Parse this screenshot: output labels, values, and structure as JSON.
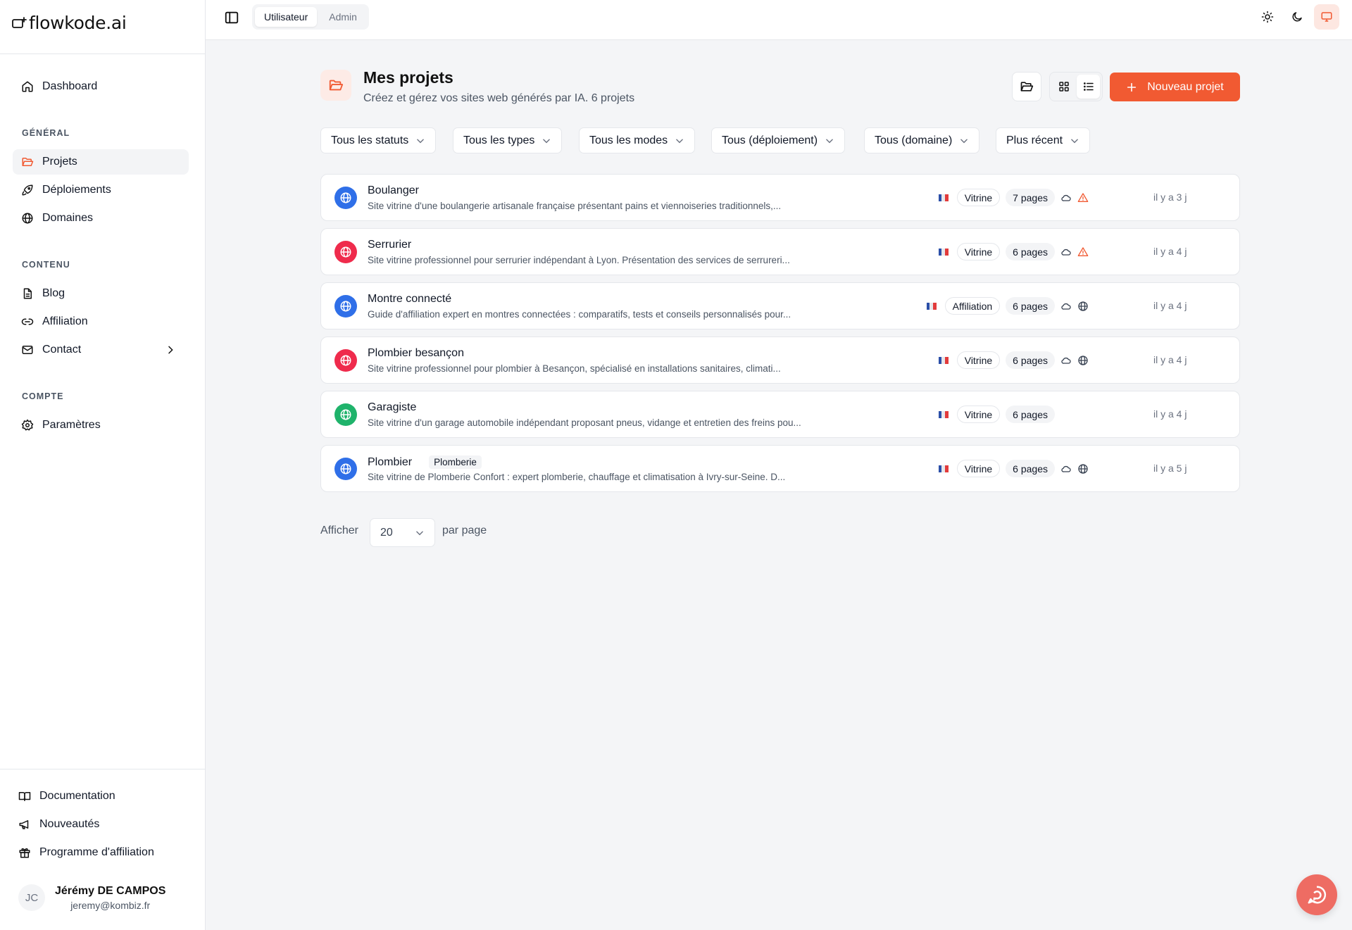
{
  "app": {
    "logo_text": "flowkode.ai",
    "accent": "#f15a32"
  },
  "sidebar": {
    "dashboard": "Dashboard",
    "sections": {
      "general": "GÉNÉRAL",
      "content": "CONTENU",
      "account": "COMPTE"
    },
    "items": {
      "projets": "Projets",
      "deploiements": "Déploiements",
      "domaines": "Domaines",
      "blog": "Blog",
      "affiliation": "Affiliation",
      "contact": "Contact",
      "parametres": "Paramètres"
    },
    "footer": {
      "documentation": "Documentation",
      "nouveautes": "Nouveautés",
      "programme": "Programme d'affiliation"
    },
    "user": {
      "initials": "JC",
      "name": "Jérémy DE CAMPOS",
      "email": "jeremy@kombiz.fr"
    }
  },
  "topbar": {
    "roles": [
      "Utilisateur",
      "Admin"
    ],
    "active_role": "Utilisateur",
    "theme_active": "system"
  },
  "page": {
    "title": "Mes projets",
    "subtitle": "Créez et gérez vos sites web générés par IA. 6 projets",
    "new_button": "Nouveau projet",
    "view_active": "list"
  },
  "filters": {
    "status": "Tous les statuts",
    "types": "Tous les types",
    "modes": "Tous les modes",
    "deployment": "Tous (déploiement)",
    "domain": "Tous (domaine)",
    "sort": "Plus récent"
  },
  "projects": [
    {
      "name": "Boulanger",
      "tag": "",
      "desc": "Site vitrine d'une boulangerie artisanale française présentant pains et viennoiseries traditionnels,...",
      "type": "Vitrine",
      "pages": "7 pages",
      "status_icon": "warning-icon",
      "time": "il y a 3 j",
      "color": "#2f6fe8"
    },
    {
      "name": "Serrurier",
      "tag": "",
      "desc": "Site vitrine professionnel pour serrurier indépendant à Lyon. Présentation des services de serrureri...",
      "type": "Vitrine",
      "pages": "6 pages",
      "status_icon": "warning-icon",
      "time": "il y a 4 j",
      "color": "#ef2b4c"
    },
    {
      "name": "Montre connecté",
      "tag": "",
      "desc": "Guide d'affiliation expert en montres connectées : comparatifs, tests et conseils personnalisés pour...",
      "type": "Affiliation",
      "pages": "6 pages",
      "status_icon": "globe-icon",
      "time": "il y a 4 j",
      "color": "#2f6fe8"
    },
    {
      "name": "Plombier besançon",
      "tag": "",
      "desc": "Site vitrine professionnel pour plombier à Besançon, spécialisé en installations sanitaires, climati...",
      "type": "Vitrine",
      "pages": "6 pages",
      "status_icon": "globe-icon",
      "time": "il y a 4 j",
      "color": "#ef2b4c"
    },
    {
      "name": "Garagiste",
      "tag": "",
      "desc": "Site vitrine d'un garage automobile indépendant proposant pneus, vidange et entretien des freins pou...",
      "type": "Vitrine",
      "pages": "6 pages",
      "status_icon": "",
      "time": "il y a 4 j",
      "color": "#1fb36b"
    },
    {
      "name": "Plombier",
      "tag": "Plomberie",
      "desc": "Site vitrine de Plomberie Confort : expert plomberie, chauffage et climatisation à Ivry-sur-Seine. D...",
      "type": "Vitrine",
      "pages": "6 pages",
      "status_icon": "globe-icon",
      "time": "il y a 5 j",
      "color": "#2f6fe8"
    }
  ],
  "pager": {
    "show": "Afficher",
    "value": "20",
    "per_page": "par page"
  }
}
